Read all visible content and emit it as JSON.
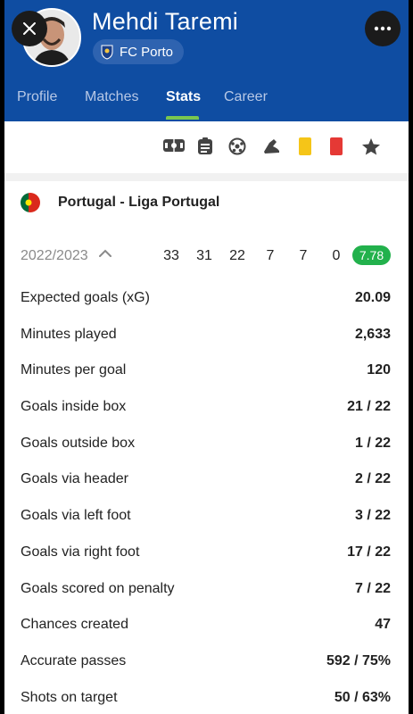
{
  "header": {
    "player_name": "Mehdi Taremi",
    "club": "FC Porto",
    "background": "#0f4da2"
  },
  "tabs": [
    {
      "label": "Profile",
      "active": false
    },
    {
      "label": "Matches",
      "active": false
    },
    {
      "label": "Stats",
      "active": true
    },
    {
      "label": "Career",
      "active": false
    }
  ],
  "filter_icons": [
    "stadium-icon",
    "match-card-icon",
    "ball-icon",
    "boot-icon",
    "yellow-card-icon",
    "red-card-icon",
    "star-icon"
  ],
  "league": {
    "name": "Portugal - Liga Portugal"
  },
  "season": {
    "label": "2022/2023",
    "summary": [
      "33",
      "31",
      "22",
      "7",
      "7",
      "0"
    ],
    "rating": "7.78",
    "rating_color": "#22b14c"
  },
  "stats": [
    {
      "label": "Expected goals (xG)",
      "value": "20.09"
    },
    {
      "label": "Minutes played",
      "value": "2,633"
    },
    {
      "label": "Minutes per goal",
      "value": "120"
    },
    {
      "label": "Goals inside box",
      "value": "21 / 22"
    },
    {
      "label": "Goals outside box",
      "value": "1 / 22"
    },
    {
      "label": "Goals via header",
      "value": "2 / 22"
    },
    {
      "label": "Goals via left foot",
      "value": "3 / 22"
    },
    {
      "label": "Goals via right foot",
      "value": "17 / 22"
    },
    {
      "label": "Goals scored on penalty",
      "value": "7 / 22"
    },
    {
      "label": "Chances created",
      "value": "47"
    },
    {
      "label": "Accurate passes",
      "value": "592 / 75%"
    },
    {
      "label": "Shots on target",
      "value": "50 / 63%"
    }
  ]
}
